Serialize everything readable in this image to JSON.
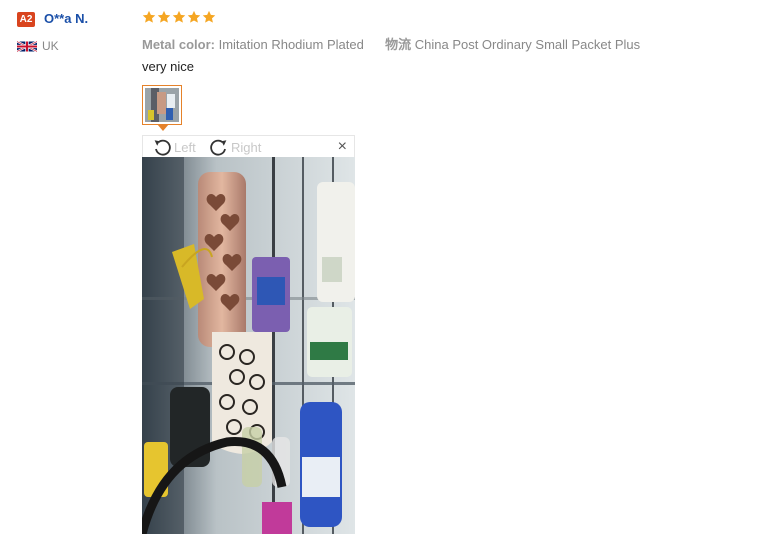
{
  "user": {
    "level_badge": "A2",
    "name": "O**a N.",
    "country": "UK",
    "flag_icon": "uk-flag-icon"
  },
  "review": {
    "rating": 5,
    "star_color": "#f5a623",
    "attributes": [
      {
        "key": "Metal color:",
        "value": "Imitation Rhodium Plated"
      },
      {
        "key": "物流",
        "value": "China Post Ordinary Small Packet Plus"
      }
    ],
    "text": "very nice",
    "thumbnail_icon": "review-photo-thumbnail"
  },
  "viewer": {
    "rotate_left_label": "Left",
    "rotate_right_label": "Right",
    "close_label": "×",
    "rotate_left_icon": "rotate-left-icon",
    "rotate_right_icon": "rotate-right-icon",
    "accent_color": "#e5822a"
  }
}
